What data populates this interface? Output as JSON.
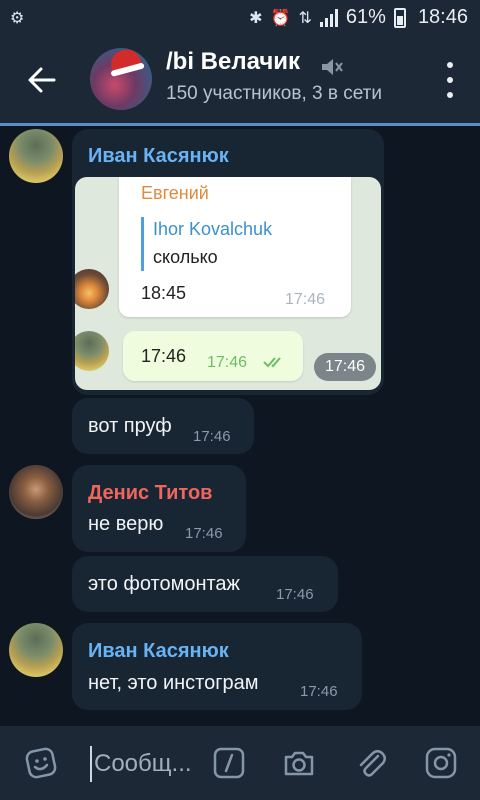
{
  "status_bar": {
    "battery": "61%",
    "time": "18:46"
  },
  "header": {
    "title": "/bi Велачик",
    "subtitle": "150 участников, 3 в сети"
  },
  "messages": [
    {
      "sender": "Иван Касянюк",
      "sender_color": "#6ab3f3",
      "photo": {
        "quoted_sender": "Евгений",
        "quote_name": "Ihor Kovalchuk",
        "quote_text": "сколько",
        "message_text": "18:45",
        "message_time": "17:46",
        "reply_text": "17:46",
        "reply_time": "17:46"
      },
      "time": "17:46"
    },
    {
      "text": "вот пруф",
      "time": "17:46"
    },
    {
      "sender": "Денис Титов",
      "sender_color": "#f0655c",
      "text": "не верю",
      "time": "17:46"
    },
    {
      "text": "это фотомонтаж",
      "time": "17:46"
    },
    {
      "sender": "Иван Касянюк",
      "sender_color": "#6ab3f3",
      "text": "нет, это инстограм",
      "time": "17:46"
    }
  ],
  "input": {
    "placeholder": "Сообщ..."
  },
  "icons": {
    "status": [
      "gear-notification-icon",
      "bluetooth-icon",
      "alarm-icon",
      "signal-icon",
      "battery-icon"
    ],
    "header": [
      "back-arrow-icon",
      "mute-icon",
      "more-vert-icon"
    ],
    "inputbar": [
      "sticker-icon",
      "bot-command-icon",
      "camera-icon",
      "attach-icon",
      "instagram-camera-icon"
    ]
  }
}
